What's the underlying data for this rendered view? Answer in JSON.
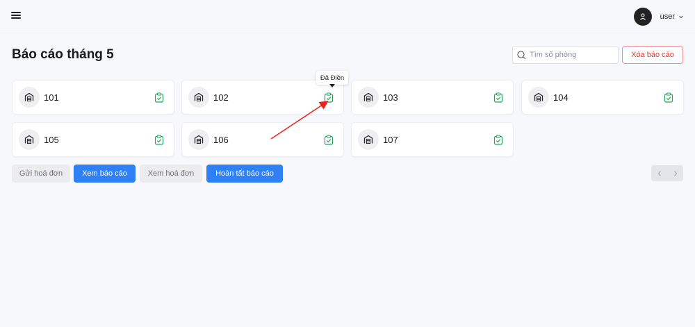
{
  "topbar": {
    "menu_icon": "hamburger-menu-icon",
    "user": {
      "name": "user",
      "avatar_icon": "user-icon",
      "chevron_icon": "chevron-down-icon"
    }
  },
  "header": {
    "title": "Báo cáo tháng 5",
    "search_placeholder": "Tìm số phòng",
    "delete_label": "Xóa báo cáo"
  },
  "rooms": [
    {
      "name": "101",
      "status": "Đã Điền",
      "icon": "door-icon",
      "status_icon": "clipboard-check-icon"
    },
    {
      "name": "102",
      "status": "Đã Điền",
      "icon": "door-icon",
      "status_icon": "clipboard-check-icon"
    },
    {
      "name": "103",
      "status": "Đã Điền",
      "icon": "door-icon",
      "status_icon": "clipboard-check-icon"
    },
    {
      "name": "104",
      "status": "Đã Điền",
      "icon": "door-icon",
      "status_icon": "clipboard-check-icon"
    },
    {
      "name": "105",
      "status": "Đã Điền",
      "icon": "door-icon",
      "status_icon": "clipboard-check-icon"
    },
    {
      "name": "106",
      "status": "Đã Điền",
      "icon": "door-icon",
      "status_icon": "clipboard-check-icon"
    },
    {
      "name": "107",
      "status": "Đã Điền",
      "icon": "door-icon",
      "status_icon": "clipboard-check-icon"
    }
  ],
  "tooltip": {
    "text": "Đã Điền"
  },
  "actions": {
    "send_invoice": "Gửi hoá đơn",
    "view_report": "Xem báo cáo",
    "view_invoice": "Xem hoá đơn",
    "complete_report": "Hoàn tất báo cáo"
  },
  "pager": {
    "prev_icon": "chevron-left-icon",
    "next_icon": "chevron-right-icon"
  },
  "colors": {
    "primary": "#2f80f4",
    "danger": "#e03a3a",
    "success": "#22a55a",
    "annotation": "#e8231c"
  }
}
